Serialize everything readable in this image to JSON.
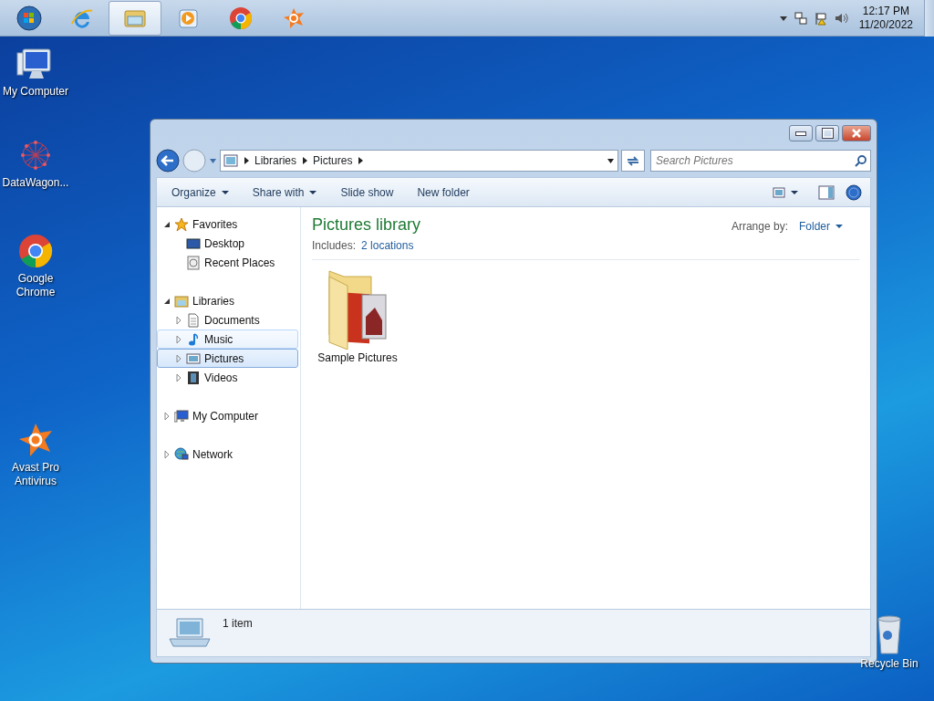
{
  "taskbar": {
    "apps": [
      {
        "selected": false
      },
      {
        "selected": false
      },
      {
        "selected": true
      },
      {
        "selected": false
      },
      {
        "selected": false
      },
      {
        "selected": false
      }
    ],
    "clock": {
      "time": "12:17 PM",
      "date": "11/20/2022"
    }
  },
  "desktop_icons": [
    {
      "label": "My Computer"
    },
    {
      "label": "DataWagon..."
    },
    {
      "label": "Google Chrome"
    },
    {
      "label": "Avast Pro Antivirus"
    }
  ],
  "recycle_bin": {
    "label": "Recycle Bin"
  },
  "window": {
    "breadcrumb": [
      "Libraries",
      "Pictures"
    ],
    "search": {
      "placeholder": "Search Pictures"
    },
    "toolbar": [
      {
        "label": "Organize",
        "dropdown": true
      },
      {
        "label": "Share with",
        "dropdown": true
      },
      {
        "label": "Slide show",
        "dropdown": false
      },
      {
        "label": "New folder",
        "dropdown": false
      }
    ],
    "nav": [
      {
        "label": "Favorites",
        "expanded": true,
        "children": [
          {
            "label": "Desktop",
            "selected": false,
            "hovered": false
          },
          {
            "label": "Recent Places",
            "selected": false,
            "hovered": false
          }
        ]
      },
      {
        "label": "Libraries",
        "expanded": true,
        "children": [
          {
            "label": "Documents",
            "expanded": false,
            "selected": false,
            "hovered": false
          },
          {
            "label": "Music",
            "expanded": false,
            "selected": false,
            "hovered": true
          },
          {
            "label": "Pictures",
            "expanded": false,
            "selected": true,
            "hovered": false
          },
          {
            "label": "Videos",
            "expanded": false,
            "selected": false,
            "hovered": false
          }
        ]
      },
      {
        "label": "My Computer",
        "expanded": false
      },
      {
        "label": "Network",
        "expanded": false
      }
    ],
    "content": {
      "title": "Pictures library",
      "includes_label": "Includes:",
      "includes_link": "2 locations",
      "arrange_label": "Arrange by:",
      "arrange_value": "Folder",
      "items": [
        {
          "label": "Sample Pictures"
        }
      ]
    },
    "details": {
      "text": "1 item"
    }
  }
}
